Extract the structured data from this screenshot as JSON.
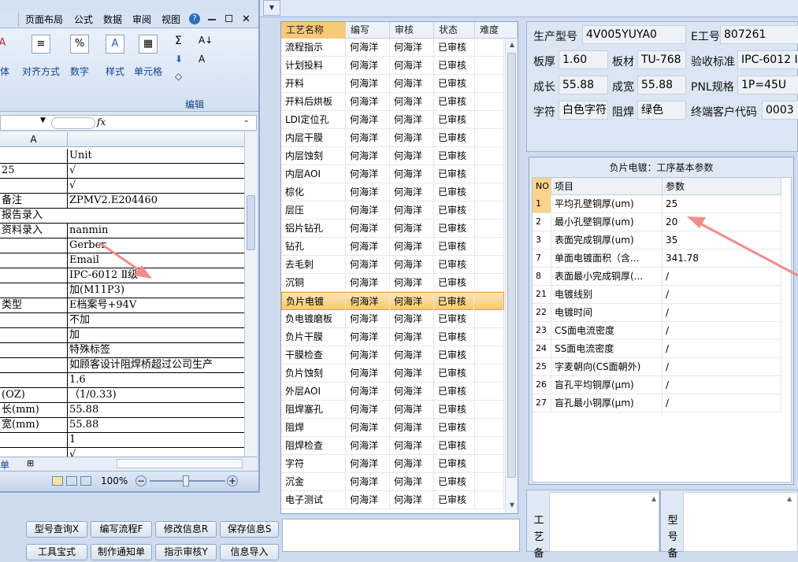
{
  "top_arrow": "▼",
  "process_list": {
    "headers": [
      "工艺名称",
      "编写",
      "审核",
      "状态",
      "难度"
    ],
    "rows": [
      [
        "流程指示",
        "何海洋",
        "何海洋",
        "已审核"
      ],
      [
        "计划投料",
        "何海洋",
        "何海洋",
        "已审核"
      ],
      [
        "开料",
        "何海洋",
        "何海洋",
        "已审核"
      ],
      [
        "开料后烘板",
        "何海洋",
        "何海洋",
        "已审核"
      ],
      [
        "LDI定位孔",
        "何海洋",
        "何海洋",
        "已审核"
      ],
      [
        "内层干膜",
        "何海洋",
        "何海洋",
        "已审核"
      ],
      [
        "内层蚀刻",
        "何海洋",
        "何海洋",
        "已审核"
      ],
      [
        "内层AOI",
        "何海洋",
        "何海洋",
        "已审核"
      ],
      [
        "棕化",
        "何海洋",
        "何海洋",
        "已审核"
      ],
      [
        "层压",
        "何海洋",
        "何海洋",
        "已审核"
      ],
      [
        "铝片钻孔",
        "何海洋",
        "何海洋",
        "已审核"
      ],
      [
        "钻孔",
        "何海洋",
        "何海洋",
        "已审核"
      ],
      [
        "去毛刺",
        "何海洋",
        "何海洋",
        "已审核"
      ],
      [
        "沉铜",
        "何海洋",
        "何海洋",
        "已审核"
      ],
      [
        "负片电镀",
        "何海洋",
        "何海洋",
        "已审核"
      ],
      [
        "负电镀磨板",
        "何海洋",
        "何海洋",
        "已审核"
      ],
      [
        "负片干膜",
        "何海洋",
        "何海洋",
        "已审核"
      ],
      [
        "干膜检查",
        "何海洋",
        "何海洋",
        "已审核"
      ],
      [
        "负片蚀刻",
        "何海洋",
        "何海洋",
        "已审核"
      ],
      [
        "外层AOI",
        "何海洋",
        "何海洋",
        "已审核"
      ],
      [
        "阻焊塞孔",
        "何海洋",
        "何海洋",
        "已审核"
      ],
      [
        "阻焊",
        "何海洋",
        "何海洋",
        "已审核"
      ],
      [
        "阻焊检查",
        "何海洋",
        "何海洋",
        "已审核"
      ],
      [
        "字符",
        "何海洋",
        "何海洋",
        "已审核"
      ],
      [
        "沉金",
        "何海洋",
        "何海洋",
        "已审核"
      ],
      [
        "电子测试",
        "何海洋",
        "何海洋",
        "已审核"
      ]
    ],
    "selected_index": 14
  },
  "info": {
    "model_label": "生产型号",
    "model_value": "4V005YUYA0",
    "eno_label": "E工号",
    "eno_value": "807261",
    "thick_label": "板厚",
    "thick_value": "1.60",
    "material_label": "板材",
    "material_value": "TU-768",
    "std_label": "验收标准",
    "std_value": "IPC-6012 I",
    "len_label": "成长",
    "len_value": "55.88",
    "wid_label": "成宽",
    "wid_value": "55.88",
    "pnl_label": "PNL规格",
    "pnl_value": "1P=45U",
    "char_label": "字符",
    "char_value": "白色字符",
    "mask_label": "阻焊",
    "mask_value": "绿色",
    "cust_label": "终端客户代码",
    "cust_value": "0003"
  },
  "params": {
    "title": "负片电镀：工序基本参数",
    "headers": [
      "NO",
      "项目",
      "参数"
    ],
    "rows": [
      [
        "1",
        "平均孔壁铜厚(um)",
        "25"
      ],
      [
        "2",
        "最小孔壁铜厚(um)",
        "20"
      ],
      [
        "3",
        "表面完成铜厚(um)",
        "35"
      ],
      [
        "7",
        "单面电镀面积（含...",
        "341.78"
      ],
      [
        "8",
        "表面最小完成铜厚(...",
        "/"
      ],
      [
        "21",
        "电镀线别",
        "/"
      ],
      [
        "22",
        "电镀时间",
        "/"
      ],
      [
        "23",
        "CS面电流密度",
        "/"
      ],
      [
        "24",
        "SS面电流密度",
        "/"
      ],
      [
        "25",
        "字麦朝向(CS面朝外)",
        "/"
      ],
      [
        "26",
        "盲孔平均铜厚(μm)",
        "/"
      ],
      [
        "27",
        "盲孔最小铜厚(μm)",
        "/"
      ]
    ],
    "selected_index": 0
  },
  "bottom": {
    "left_label": "工艺备",
    "right_label": "型号备"
  },
  "buttons": [
    {
      "label": "型号查询X"
    },
    {
      "label": "编写流程F"
    },
    {
      "label": "修改信息R"
    },
    {
      "label": "保存信息S"
    },
    {
      "label": "工具宝式"
    },
    {
      "label": "制作通知单"
    },
    {
      "label": "指示审核Y"
    },
    {
      "label": "信息导入"
    }
  ],
  "excel": {
    "tabs": [
      "页面布局",
      "公式",
      "数据",
      "审阅",
      "视图"
    ],
    "help_icon": "?",
    "ribbon": {
      "font_label": "体",
      "align_label": "对齐方式",
      "number_label": "数字",
      "style_label": "样式",
      "cell_label": "单元格",
      "edit_label": "编辑",
      "sigma": "Σ",
      "sort": "A↓",
      "find": "A",
      "pct": "%"
    },
    "fx": "fx",
    "col_a": "A",
    "rows": [
      [
        "",
        "Unit"
      ],
      [
        "25",
        "√"
      ],
      [
        "",
        "√"
      ],
      [
        "备注",
        "ZPMV2.E204460"
      ],
      [
        "报告录入",
        ""
      ],
      [
        "资料录入",
        "nanmin"
      ],
      [
        "",
        "Gerber"
      ],
      [
        "",
        "Email"
      ],
      [
        "",
        "IPC-6012 Ⅱ级"
      ],
      [
        "",
        "加(M11P3)"
      ],
      [
        "类型",
        "E档案号+94V"
      ],
      [
        "",
        "不加"
      ],
      [
        "",
        "加"
      ],
      [
        "",
        "特殊标签"
      ],
      [
        "",
        "如顾客设计阻焊桥超过公司生产"
      ],
      [
        "",
        "1.6"
      ],
      [
        "(OZ)",
        "（1/0.33)"
      ],
      [
        "长(mm)",
        "55.88"
      ],
      [
        "宽(mm)",
        "55.88"
      ],
      [
        "",
        "1"
      ],
      [
        "",
        "√"
      ]
    ],
    "sheet_tab": "单",
    "zoom": "100%"
  }
}
